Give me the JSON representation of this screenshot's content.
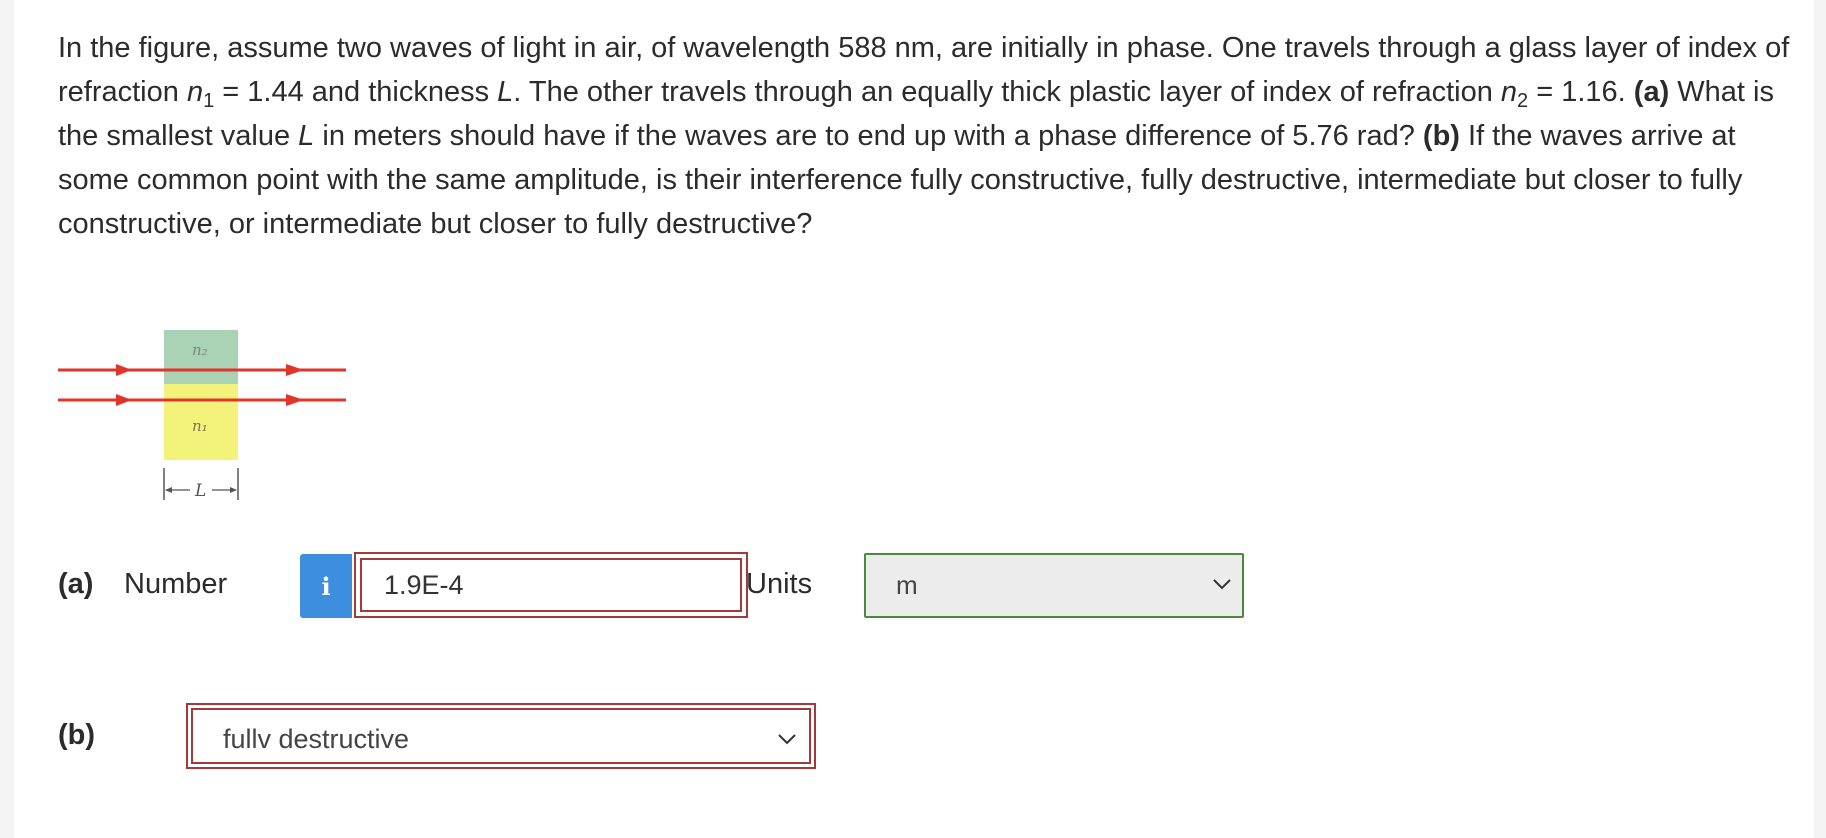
{
  "question": {
    "s1": "In the figure, assume two waves of light in air, of wavelength 588 nm, are initially in phase. One travels through a glass layer of index of refraction ",
    "n1_var": "n",
    "n1_sub": "1",
    "s2": " = 1.44 and thickness ",
    "L_var": "L",
    "s3": ". The other travels through an equally thick plastic layer of index of refraction ",
    "n2_var": "n",
    "n2_sub": "2",
    "s4": " = 1.16. ",
    "a_tag": "(a)",
    "s5": " What is the smallest value ",
    "L_var2": "L",
    "s6": " in meters should have if the waves are to end up with a phase difference of 5.76 rad? ",
    "b_tag": "(b)",
    "s7": " If the waves arrive at some common point with the same amplitude, is their interference fully constructive, fully destructive, intermediate but closer to fully constructive, or intermediate but closer to fully destructive?"
  },
  "figure": {
    "n2_label": "n₂",
    "n1_label": "n₁",
    "L_label": "L",
    "colors": {
      "ray": "#e0352b",
      "plastic": "#a9d3b4",
      "glass": "#f3f27a"
    }
  },
  "part_a": {
    "tag": "(a)",
    "label": "Number",
    "info_icon": "i",
    "value": "1.9E-4",
    "units_label": "Units",
    "units_value": "m"
  },
  "part_b": {
    "tag": "(b)",
    "value": "fullv destructive"
  }
}
